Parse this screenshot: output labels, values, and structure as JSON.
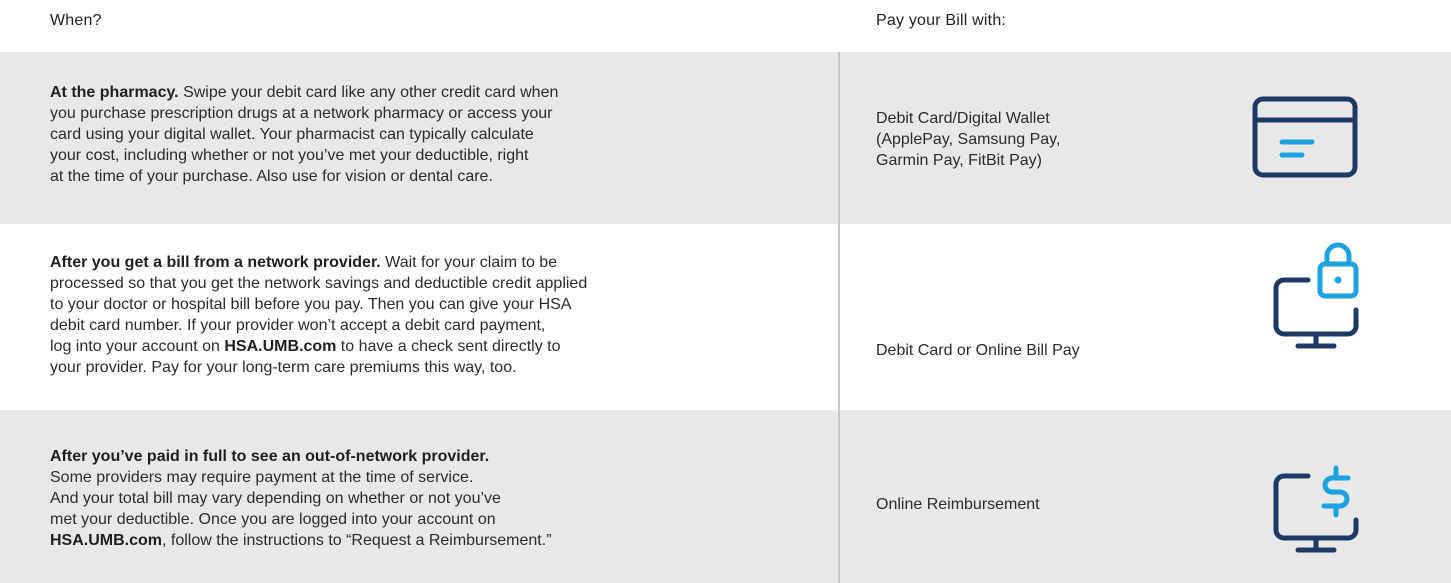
{
  "header": {
    "when_label": "When?",
    "pay_label": "Pay your Bill with:"
  },
  "rows": [
    {
      "lead": "At the pharmacy.",
      "body_lines": [
        " Swipe your debit card like any other credit card when",
        "you purchase prescription drugs at a network pharmacy or access your",
        "card using your digital wallet. Your pharmacist can typically calculate",
        "your cost, including whether or not you’ve met your deductible, right",
        "at the time of your purchase. Also use for vision or dental care."
      ],
      "method_lines": [
        "Debit Card/Digital Wallet",
        "(ApplePay, Samsung Pay,",
        "Garmin Pay, FitBit Pay)"
      ],
      "icon": "credit-card-icon"
    },
    {
      "lead": "After you get a bill from a network provider.",
      "body_lines": [
        " Wait for your claim to be",
        "processed so that you get the network savings and deductible credit applied",
        "to your doctor or hospital bill before you pay. Then you can give your HSA",
        "debit card number. If your provider won’t accept a debit card payment,",
        "log into your account on ",
        "HSA.UMB.com",
        " to have a check sent directly to",
        "your provider. Pay for your long-term care premiums this way, too."
      ],
      "method_lines": [
        "Debit Card or Online Bill Pay"
      ],
      "icon": "computer-lock-icon"
    },
    {
      "lead": "After you’ve paid in full to see an out-of-network provider.",
      "body_lines": [
        "Some providers may require payment at the time of service.",
        "And your total bill may vary depending on whether or not you’ve",
        "met your deductible. Once you are logged into your account on",
        "HSA.UMB.com",
        ", follow the instructions to “Request a Reimbursement.”"
      ],
      "method_lines": [
        "Online Reimbursement"
      ],
      "icon": "computer-dollar-icon"
    }
  ],
  "colors": {
    "icon_dark": "#1b3a66",
    "icon_accent": "#1ea1e0",
    "row_gray": "#e8e8e8",
    "divider": "#c7c7c7"
  }
}
